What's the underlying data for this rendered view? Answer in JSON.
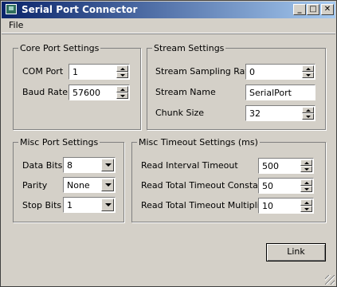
{
  "window": {
    "title": "Serial Port Connector",
    "controls": [
      "_",
      "□",
      "✕"
    ]
  },
  "menu": {
    "file": "File"
  },
  "core_port": {
    "title": "Core Port Settings",
    "com_port_label": "COM Port",
    "com_port_value": "1",
    "baud_rate_label": "Baud Rate",
    "baud_rate_value": "57600"
  },
  "stream": {
    "title": "Stream Settings",
    "sampling_rate_label": "Stream Sampling Rate",
    "sampling_rate_value": "0",
    "stream_name_label": "Stream Name",
    "stream_name_value": "SerialPort",
    "chunk_size_label": "Chunk Size",
    "chunk_size_value": "32"
  },
  "misc_port": {
    "title": "Misc Port Settings",
    "data_bits_label": "Data Bits",
    "data_bits_value": "8",
    "parity_label": "Parity",
    "parity_value": "None",
    "stop_bits_label": "Stop Bits",
    "stop_bits_value": "1"
  },
  "misc_timeout": {
    "title": "Misc Timeout Settings (ms)",
    "read_interval_label": "Read Interval Timeout",
    "read_interval_value": "500",
    "read_total_constant_label": "Read Total Timeout Constant",
    "read_total_constant_value": "50",
    "read_total_multiplier_label": "Read Total Timeout Multiplier",
    "read_total_multiplier_value": "10"
  },
  "actions": {
    "link": "Link"
  }
}
